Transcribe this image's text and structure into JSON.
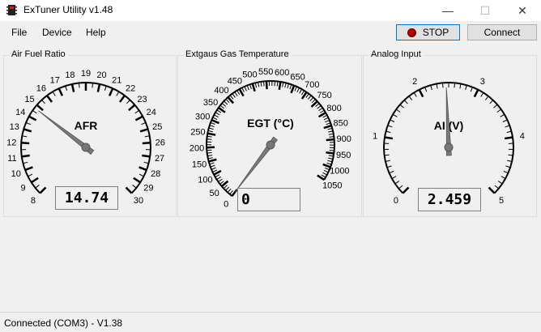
{
  "window": {
    "title": "ExTuner Utility  v1.48",
    "minimize": "—",
    "maximize": "☐",
    "close": "✕"
  },
  "menu": [
    "File",
    "Device",
    "Help"
  ],
  "toolbar": {
    "stop_label": "STOP",
    "connect_label": "Connect",
    "stop_led_color": "#c00000"
  },
  "panels": [
    {
      "title": "Air Fuel Ratio",
      "gauge_label": "AFR",
      "readout": "14.74",
      "min": 8,
      "max": 30,
      "value": 14.74,
      "labels": [
        8,
        9,
        10,
        11,
        12,
        13,
        14,
        15,
        16,
        17,
        18,
        19,
        20,
        21,
        22,
        23,
        24,
        25,
        26,
        27,
        28,
        29,
        30
      ],
      "minor_per_major": 1
    },
    {
      "title": "Extgaus Gas Temperature",
      "gauge_label": "EGT (°C)",
      "readout": "0",
      "min": 0,
      "max": 1050,
      "value": 0,
      "labels": [
        0,
        50,
        100,
        150,
        200,
        250,
        300,
        350,
        400,
        450,
        500,
        550,
        600,
        650,
        700,
        750,
        800,
        850,
        900,
        950,
        1000,
        1050
      ],
      "minor_per_major": 4
    },
    {
      "title": "Analog Input",
      "gauge_label": "AI (V)",
      "readout": "2.459",
      "min": 0,
      "max": 5,
      "value": 2.459,
      "labels": [
        0,
        1,
        2,
        3,
        4,
        5
      ],
      "minor_per_major": 9
    }
  ],
  "status": {
    "text": "Connected (COM3) - V1.38"
  }
}
